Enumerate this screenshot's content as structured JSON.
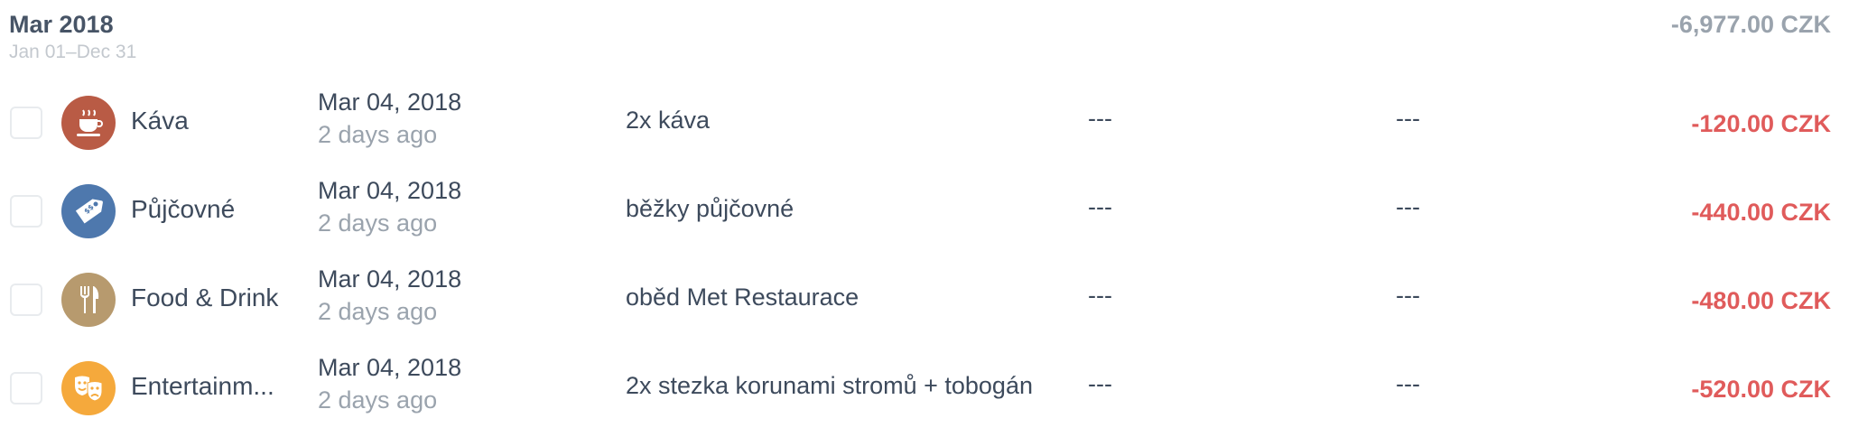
{
  "group": {
    "title": "Mar 2018",
    "range": "Jan 01–Dec 31",
    "total": "-6,977.00 CZK"
  },
  "colors": {
    "expense": "#e05b5b",
    "muted": "#9aa3ad"
  },
  "transactions": [
    {
      "category": "Káva",
      "icon": "coffee-cup-icon",
      "icon_color": "#b95b45",
      "date": "Mar 04, 2018",
      "relative": "2 days ago",
      "note": "2x káva",
      "col_a": "---",
      "col_b": "---",
      "amount": "-120.00 CZK"
    },
    {
      "category": "Půjčovné",
      "icon": "price-tag-icon",
      "icon_color": "#4e78ad",
      "date": "Mar 04, 2018",
      "relative": "2 days ago",
      "note": "běžky půjčovné",
      "col_a": "---",
      "col_b": "---",
      "amount": "-440.00 CZK"
    },
    {
      "category": "Food & Drink",
      "icon": "fork-knife-icon",
      "icon_color": "#b79a6e",
      "date": "Mar 04, 2018",
      "relative": "2 days ago",
      "note": "oběd Met Restaurace",
      "col_a": "---",
      "col_b": "---",
      "amount": "-480.00 CZK"
    },
    {
      "category": "Entertainm...",
      "icon": "theater-masks-icon",
      "icon_color": "#f5a93c",
      "date": "Mar 04, 2018",
      "relative": "2 days ago",
      "note": "2x stezka korunami stromů + tobogán",
      "col_a": "---",
      "col_b": "---",
      "amount": "-520.00 CZK"
    }
  ]
}
